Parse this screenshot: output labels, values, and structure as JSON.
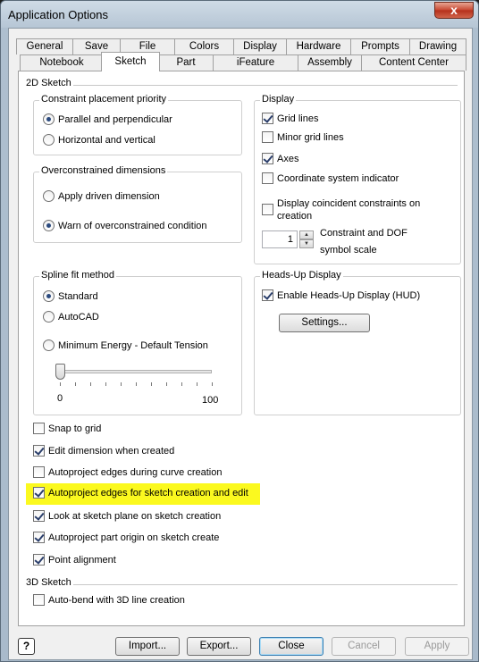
{
  "window": {
    "title": "Application Options",
    "close_glyph": "x"
  },
  "tabs_row1": [
    "General",
    "Save",
    "File",
    "Colors",
    "Display",
    "Hardware",
    "Prompts",
    "Drawing"
  ],
  "tabs_row2": [
    "Notebook",
    "Sketch",
    "Part",
    "iFeature",
    "Assembly",
    "Content Center"
  ],
  "selected_tab": "Sketch",
  "sketch2d": {
    "section_label": "2D Sketch",
    "constraint_priority": {
      "title": "Constraint placement priority",
      "options": [
        "Parallel and perpendicular",
        "Horizontal and vertical"
      ],
      "selected": "Parallel and perpendicular"
    },
    "overconstrained": {
      "title": "Overconstrained dimensions",
      "options": [
        "Apply driven dimension",
        "Warn of overconstrained condition"
      ],
      "selected": "Warn of overconstrained condition"
    },
    "display": {
      "title": "Display",
      "grid_lines": {
        "label": "Grid lines",
        "checked": true
      },
      "minor_grid_lines": {
        "label": "Minor grid lines",
        "checked": false
      },
      "axes": {
        "label": "Axes",
        "checked": true
      },
      "coordinate_indicator": {
        "label": "Coordinate system indicator",
        "checked": false
      },
      "coincident_line1": "Display coincident constraints on",
      "coincident_line2": "creation",
      "coincident_checked": false,
      "symbol_scale_value": "1",
      "symbol_scale_line1": "Constraint and DOF",
      "symbol_scale_line2": "symbol scale"
    },
    "spline_fit": {
      "title": "Spline fit method",
      "options": [
        "Standard",
        "AutoCAD",
        "Minimum Energy - Default Tension"
      ],
      "selected": "Standard",
      "tension_min": "0",
      "tension_max": "100",
      "tension_value": 0
    },
    "hud": {
      "title": "Heads-Up Display",
      "enable": {
        "label": "Enable Heads-Up Display (HUD)",
        "checked": true
      },
      "settings_label": "Settings..."
    },
    "options": {
      "snap_to_grid": {
        "label": "Snap to grid",
        "checked": false
      },
      "edit_dimension": {
        "label": "Edit dimension when created",
        "checked": true
      },
      "autoproject_curve": {
        "label": "Autoproject edges during curve creation",
        "checked": false
      },
      "autoproject_sketch": {
        "label": "Autoproject edges for sketch creation and edit",
        "checked": true
      },
      "look_at_plane": {
        "label": "Look at sketch plane on sketch creation",
        "checked": true
      },
      "autoproject_origin": {
        "label": "Autoproject part origin on sketch create",
        "checked": true
      },
      "point_alignment": {
        "label": "Point alignment",
        "checked": true
      }
    }
  },
  "sketch3d": {
    "section_label": "3D Sketch",
    "auto_bend": {
      "label": "Auto-bend with 3D line creation",
      "checked": false
    }
  },
  "footer": {
    "help_glyph": "?",
    "import_label": "Import...",
    "export_label": "Export...",
    "close_label": "Close",
    "cancel_label": "Cancel",
    "apply_label": "Apply"
  },
  "colors": {
    "highlight": "#fbf91f",
    "close_button": "#c7452f"
  }
}
